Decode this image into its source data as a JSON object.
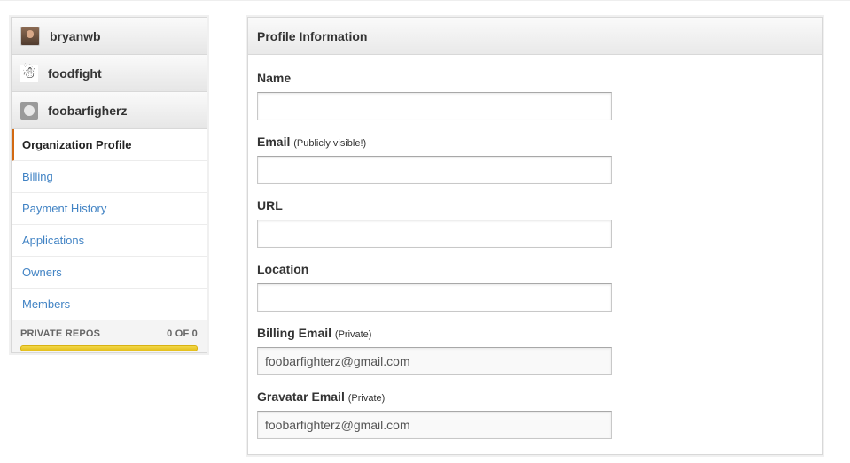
{
  "sidebar": {
    "accounts": [
      {
        "name": "bryanwb",
        "icon": "user-photo-avatar"
      },
      {
        "name": "foodfight",
        "icon": "sketch-avatar"
      },
      {
        "name": "foobarfigherz",
        "icon": "octocat-avatar"
      }
    ],
    "menu": [
      {
        "label": "Organization Profile",
        "active": true
      },
      {
        "label": "Billing"
      },
      {
        "label": "Payment History"
      },
      {
        "label": "Applications"
      },
      {
        "label": "Owners"
      },
      {
        "label": "Members"
      }
    ],
    "private_repos": {
      "label": "PRIVATE REPOS",
      "count": "0 OF 0"
    }
  },
  "panel": {
    "title": "Profile Information",
    "fields": [
      {
        "label": "Name",
        "note": "",
        "value": "",
        "placeholder": ""
      },
      {
        "label": "Email",
        "note": "(Publicly visible!)",
        "value": ""
      },
      {
        "label": "URL",
        "note": "",
        "value": ""
      },
      {
        "label": "Location",
        "note": "",
        "value": ""
      },
      {
        "label": "Billing Email",
        "note": "(Private)",
        "value": "foobarfighterz@gmail.com"
      },
      {
        "label": "Gravatar Email",
        "note": "(Private)",
        "value": "foobarfighterz@gmail.com"
      }
    ]
  },
  "colors": {
    "link": "#4183c4",
    "active_indicator": "#d26911",
    "progress": "#e4bf19"
  }
}
